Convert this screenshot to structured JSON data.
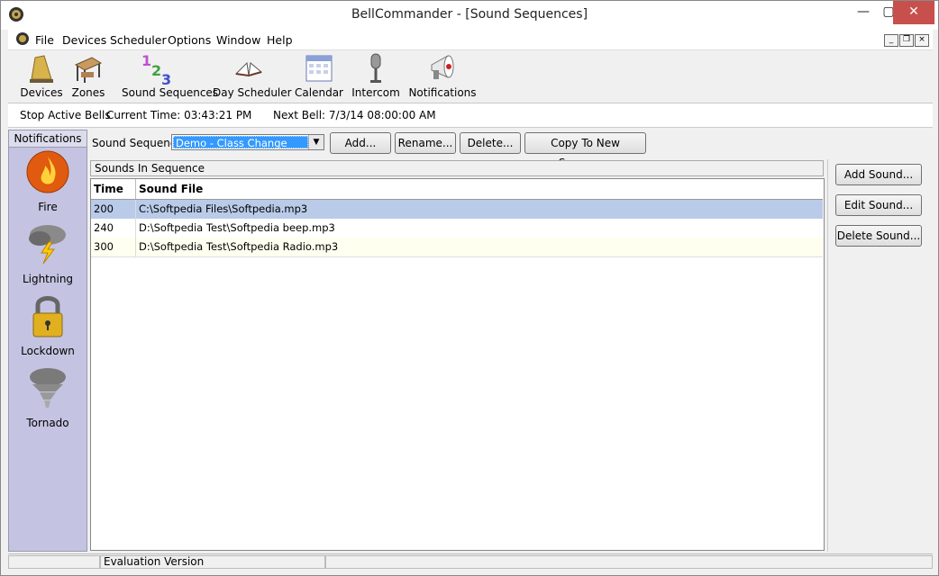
{
  "window": {
    "title": "BellCommander - [Sound Sequences]"
  },
  "menu": {
    "items": [
      "File",
      "Devices",
      "Scheduler",
      "Options",
      "Window",
      "Help"
    ]
  },
  "toolbar": {
    "items": [
      {
        "label": "Devices",
        "icon": "bell-icon"
      },
      {
        "label": "Zones",
        "icon": "desk-icon"
      },
      {
        "label": "Sound Sequences",
        "icon": "numbers-123-icon"
      },
      {
        "label": "Day Scheduler",
        "icon": "open-book-icon"
      },
      {
        "label": "Calendar",
        "icon": "calendar-icon"
      },
      {
        "label": "Intercom",
        "icon": "microphone-icon"
      },
      {
        "label": "Notifications",
        "icon": "megaphone-icon"
      }
    ]
  },
  "infobar": {
    "stop_bells": "Stop Active Bells",
    "current_time": "Current Time: 03:43:21 PM",
    "next_bell": "Next Bell: 7/3/14 08:00:00 AM"
  },
  "sidebar": {
    "header": "Notifications",
    "items": [
      {
        "label": "Fire",
        "icon": "fire-icon"
      },
      {
        "label": "Lightning",
        "icon": "lightning-icon"
      },
      {
        "label": "Lockdown",
        "icon": "padlock-icon"
      },
      {
        "label": "Tornado",
        "icon": "tornado-icon"
      }
    ]
  },
  "sequence": {
    "label": "Sound Sequence:",
    "selected": "Demo - Class Change",
    "buttons": {
      "add": "Add...",
      "rename": "Rename...",
      "delete": "Delete...",
      "copy": "Copy To New Sequence"
    }
  },
  "panel": {
    "title": "Sounds In Sequence",
    "columns": [
      "Time",
      "Sound File"
    ],
    "rows": [
      {
        "time": "200",
        "file": "C:\\Softpedia Files\\Softpedia.mp3"
      },
      {
        "time": "240",
        "file": "D:\\Softpedia Test\\Softpedia beep.mp3"
      },
      {
        "time": "300",
        "file": "D:\\Softpedia Test\\Softpedia Radio.mp3"
      }
    ]
  },
  "right_buttons": {
    "add": "Add Sound...",
    "edit": "Edit Sound...",
    "delete": "Delete Sound..."
  },
  "statusbar": {
    "text": "Evaluation Version"
  },
  "colors": {
    "selected_row": "#b9cbe8",
    "alt_row": "#fffff0",
    "sidebar": "#c4c4e2",
    "close_button": "#c7504d"
  }
}
